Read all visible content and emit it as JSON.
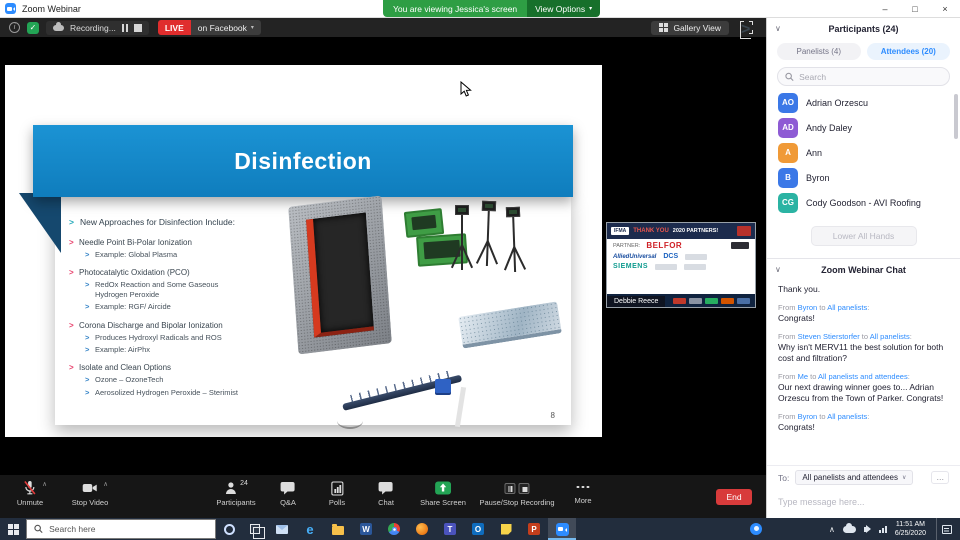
{
  "icons": {
    "minimize": "–",
    "maximize": "□",
    "close": "×",
    "collapse": "∨",
    "chevron_up": "∧",
    "dropdown": "▾",
    "info": "i",
    "check": "✓"
  },
  "titlebar": {
    "app_title": "Zoom Webinar",
    "banner_text": "You are viewing Jessica's screen",
    "view_options_label": "View Options"
  },
  "meetingbar": {
    "recording_label": "Recording...",
    "live_label": "LIVE",
    "live_target": "on Facebook",
    "gallery_view_label": "Gallery View"
  },
  "slide": {
    "title": "Disinfection",
    "intro": "New Approaches for Disinfection Include:",
    "bullets": [
      {
        "level": 1,
        "text": "Needle Point Bi-Polar Ionization"
      },
      {
        "level": 2,
        "text": "Example: Global Plasma"
      },
      {
        "level": 1,
        "text": "Photocatalytic Oxidation (PCO)"
      },
      {
        "level": 2,
        "text": "RedOx Reaction and Some Gaseous Hydrogen Peroxide"
      },
      {
        "level": 2,
        "text": "Example: RGF/ Aircide"
      },
      {
        "level": 1,
        "text": "Corona Discharge and Bipolar Ionization"
      },
      {
        "level": 2,
        "text": "Produces Hydroxyl Radicals and ROS"
      },
      {
        "level": 2,
        "text": "Example: AirPhx"
      },
      {
        "level": 1,
        "text": "Isolate and Clean Options"
      },
      {
        "level": 2,
        "text": "Ozone – OzoneTech"
      },
      {
        "level": 2,
        "text": "Aerosolized Hydrogen Peroxide – Sterimist"
      }
    ],
    "page_number": "8"
  },
  "thumbnail": {
    "speaker_name": "Debbie Reece",
    "logo_ifma": "IFMA",
    "header_thanks": "THANK YOU",
    "header_partners": "2020 PARTNERS!",
    "partner_label": "PARTNER:",
    "logo_belfor": "BELFOR",
    "logo_allied": "AlliedUniversal",
    "logo_dcs": "DCS",
    "logo_siemens": "SIEMENS"
  },
  "participants": {
    "title": "Participants (24)",
    "tab_panelists": "Panelists (4)",
    "tab_attendees": "Attendees (20)",
    "search_placeholder": "Search",
    "items": [
      {
        "initials": "AO",
        "name": "Adrian Orzescu",
        "color": "#3b78e7"
      },
      {
        "initials": "AD",
        "name": "Andy Daley",
        "color": "#8e5bd4"
      },
      {
        "initials": "A",
        "name": "Ann",
        "color": "#f09a37"
      },
      {
        "initials": "B",
        "name": "Byron",
        "color": "#3b78e7"
      },
      {
        "initials": "CG",
        "name": "Cody Goodson - AVI Roofing",
        "color": "#2bb3a3"
      }
    ],
    "lower_all_hands": "Lower All Hands"
  },
  "chat": {
    "title": "Zoom Webinar Chat",
    "meta_from": "From",
    "meta_to": "to",
    "partial_body": "Thank you.",
    "messages": [
      {
        "from": "Byron",
        "to": "All panelists",
        "body": "Congrats!"
      },
      {
        "from": "Steven Stierstorfer",
        "to": "All panelists",
        "body": "Why isn't MERV11 the best solution for both cost and filtration?"
      },
      {
        "from": "Me",
        "to": "All panelists and attendees",
        "body": "Our next drawing winner goes to... Adrian Orzescu from the Town of Parker. Congrats!"
      },
      {
        "from": "Byron",
        "to": "All panelists",
        "body": "Congrats!"
      }
    ],
    "to_label": "To:",
    "to_value": "All panelists and attendees",
    "more_label": "...",
    "input_placeholder": "Type message here..."
  },
  "toolbar": {
    "items": [
      {
        "label": "Unmute"
      },
      {
        "label": "Stop Video"
      },
      {
        "label": "Participants",
        "badge": "24"
      },
      {
        "label": "Q&A"
      },
      {
        "label": "Polls"
      },
      {
        "label": "Chat"
      },
      {
        "label": "Share Screen"
      },
      {
        "label": "Pause/Stop Recording"
      },
      {
        "label": "More"
      }
    ],
    "end_label": "End"
  },
  "taskbar": {
    "search_placeholder": "Search here",
    "time": "11:51 AM",
    "date": "6/25/2020"
  }
}
